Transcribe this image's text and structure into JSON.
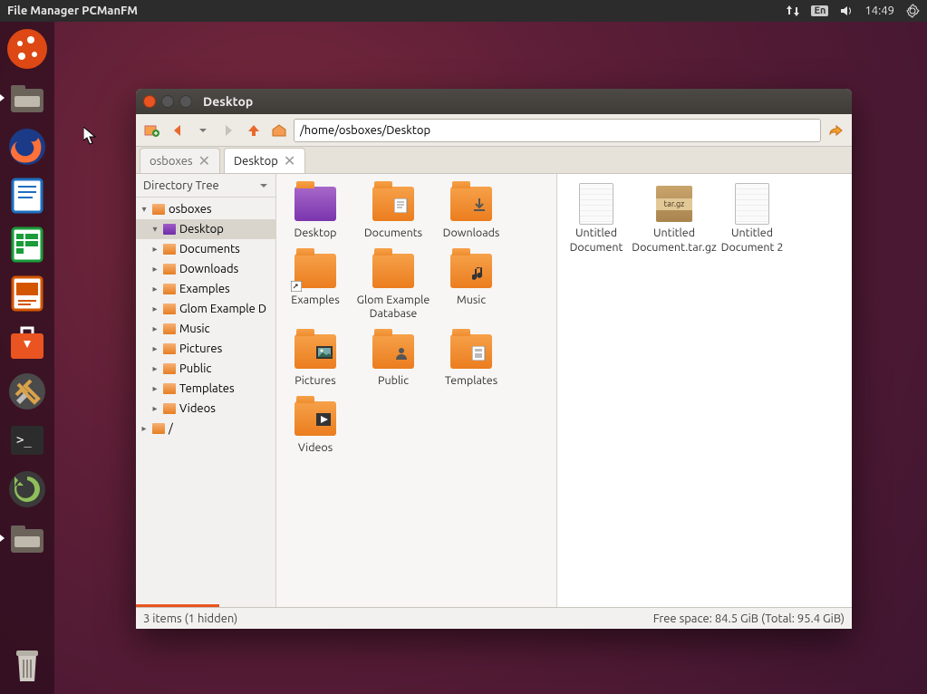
{
  "panel": {
    "app_title": "File Manager PCManFM",
    "lang": "En",
    "time": "14:49"
  },
  "launcher": [
    {
      "name": "dash",
      "color": "#dd4814",
      "running": false
    },
    {
      "name": "files",
      "color": "#5a5552",
      "running": true
    },
    {
      "name": "firefox",
      "color": "#ff7139",
      "running": false
    },
    {
      "name": "writer",
      "color": "#1e6fbf",
      "running": false
    },
    {
      "name": "calc",
      "color": "#1a9c3a",
      "running": false
    },
    {
      "name": "impress",
      "color": "#d45500",
      "running": false
    },
    {
      "name": "software",
      "color": "#e95420",
      "running": false
    },
    {
      "name": "settings",
      "color": "#4a4a4a",
      "running": false
    },
    {
      "name": "terminal",
      "color": "#2c2c2c",
      "running": false
    },
    {
      "name": "updater",
      "color": "#3a3a3a",
      "running": false
    },
    {
      "name": "pcmanfm",
      "color": "#5a5552",
      "running": true
    }
  ],
  "trash_name": "trash",
  "window": {
    "title": "Desktop",
    "path": "/home/osboxes/Desktop",
    "tabs": [
      {
        "label": "osboxes",
        "active": false
      },
      {
        "label": "Desktop",
        "active": true
      }
    ],
    "side_header": "Directory Tree",
    "tree": [
      {
        "label": "osboxes",
        "depth": 0,
        "expanded": true,
        "icon": "home"
      },
      {
        "label": "Desktop",
        "depth": 1,
        "expanded": true,
        "icon": "desktop",
        "selected": true
      },
      {
        "label": "Documents",
        "depth": 1,
        "icon": "folder"
      },
      {
        "label": "Downloads",
        "depth": 1,
        "icon": "folder"
      },
      {
        "label": "Examples",
        "depth": 1,
        "icon": "folder"
      },
      {
        "label": "Glom Example D",
        "depth": 1,
        "icon": "folder"
      },
      {
        "label": "Music",
        "depth": 1,
        "icon": "folder"
      },
      {
        "label": "Pictures",
        "depth": 1,
        "icon": "folder"
      },
      {
        "label": "Public",
        "depth": 1,
        "icon": "folder"
      },
      {
        "label": "Templates",
        "depth": 1,
        "icon": "folder"
      },
      {
        "label": "Videos",
        "depth": 1,
        "icon": "folder"
      },
      {
        "label": "/",
        "depth": 0,
        "icon": "folder"
      }
    ],
    "left_pane": [
      {
        "label": "Desktop",
        "kind": "desktop"
      },
      {
        "label": "Documents",
        "kind": "folder",
        "overlay": "doc"
      },
      {
        "label": "Downloads",
        "kind": "folder",
        "overlay": "down"
      },
      {
        "label": "Examples",
        "kind": "folder",
        "link": true
      },
      {
        "label": "Glom Example Database",
        "kind": "folder"
      },
      {
        "label": "Music",
        "kind": "folder",
        "overlay": "music"
      },
      {
        "label": "Pictures",
        "kind": "folder",
        "overlay": "pic"
      },
      {
        "label": "Public",
        "kind": "folder",
        "overlay": "public"
      },
      {
        "label": "Templates",
        "kind": "folder",
        "overlay": "tmpl"
      },
      {
        "label": "Videos",
        "kind": "folder",
        "overlay": "video"
      }
    ],
    "right_pane": [
      {
        "label": "Untitled Document",
        "kind": "doc"
      },
      {
        "label": "Untitled Document.tar.gz",
        "kind": "tar"
      },
      {
        "label": "Untitled Document 2",
        "kind": "doc"
      }
    ],
    "status_left": "3 items (1 hidden)",
    "status_right": "Free space: 84.5 GiB (Total: 95.4 GiB)"
  }
}
